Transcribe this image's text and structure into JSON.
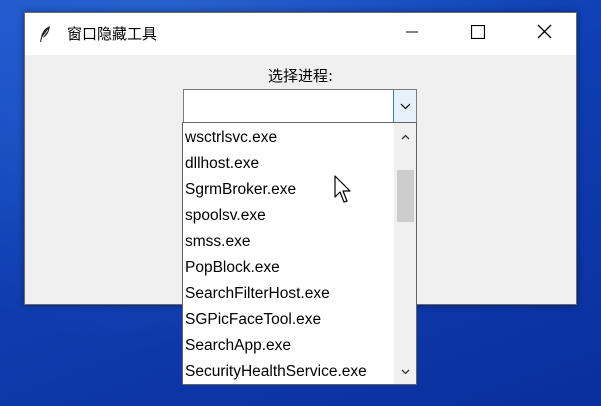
{
  "window": {
    "title": "窗口隐藏工具",
    "app_icon": "feather-icon",
    "controls": [
      "minimize-icon",
      "maximize-icon",
      "close-icon"
    ]
  },
  "main": {
    "label": "选择进程:",
    "combo": {
      "value": "",
      "dropdown_icon": "chevron-down-icon",
      "options": [
        "wsctrlsvc.exe",
        "dllhost.exe",
        "SgrmBroker.exe",
        "spoolsv.exe",
        "smss.exe",
        "PopBlock.exe",
        "SearchFilterHost.exe",
        "SGPicFaceTool.exe",
        "SearchApp.exe",
        "SecurityHealthService.exe"
      ]
    }
  },
  "colors": {
    "desktop": "#1c55c9",
    "window_bg": "#f0f0f0",
    "titlebar_bg": "#ffffff",
    "dropdown_button_bg": "#e5f1fb",
    "dropdown_button_border": "#3c7fb1",
    "scroll_thumb": "#cdcdcd"
  }
}
